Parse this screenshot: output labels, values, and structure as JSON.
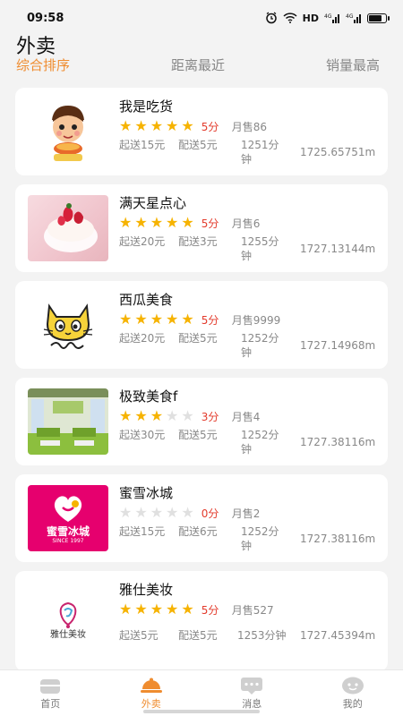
{
  "status_bar": {
    "time": "09:58",
    "network": "HD",
    "signal1": "4G",
    "signal2": "4G"
  },
  "page_title": "外卖",
  "sort_tabs": [
    {
      "label": "综合排序",
      "active": true
    },
    {
      "label": "距离最近",
      "active": false
    },
    {
      "label": "销量最高",
      "active": false
    }
  ],
  "shops": [
    {
      "name": "我是吃货",
      "stars": 5,
      "score": "5分",
      "monthly": "月售86",
      "min_order": "起送15元",
      "delivery_fee": "配送5元",
      "time": "1251分钟",
      "distance": "1725.65751m",
      "thumb": "cartoon-boy-logo"
    },
    {
      "name": "满天星点心",
      "stars": 5,
      "score": "5分",
      "monthly": "月售6",
      "min_order": "起送20元",
      "delivery_fee": "配送3元",
      "time": "1255分钟",
      "distance": "1727.13144m",
      "thumb": "cake-photo"
    },
    {
      "name": "西瓜美食",
      "stars": 5,
      "score": "5分",
      "monthly": "月售9999",
      "min_order": "起送20元",
      "delivery_fee": "配送5元",
      "time": "1252分钟",
      "distance": "1727.14968m",
      "thumb": "cat-logo"
    },
    {
      "name": "极致美食f",
      "stars": 3,
      "score": "3分",
      "monthly": "月售4",
      "min_order": "起送30元",
      "delivery_fee": "配送5元",
      "time": "1252分钟",
      "distance": "1727.38116m",
      "thumb": "restaurant-interior-photo"
    },
    {
      "name": "蜜雪冰城",
      "stars": 0,
      "score": "0分",
      "monthly": "月售2",
      "min_order": "起送15元",
      "delivery_fee": "配送6元",
      "time": "1252分钟",
      "distance": "1727.38116m",
      "thumb": "mixue-logo",
      "logo_text": "蜜雪冰城",
      "logo_sub": "SINCE 1997"
    },
    {
      "name": "雅仕美妆",
      "stars": 5,
      "score": "5分",
      "monthly": "月售527",
      "min_order": "起送5元",
      "delivery_fee": "配送5元",
      "time": "1253分钟",
      "distance": "1727.45394m",
      "thumb": "beauty-logo",
      "logo_text": "雅仕美妆"
    }
  ],
  "tabbar": [
    {
      "label": "首页",
      "icon": "home-icon",
      "active": false
    },
    {
      "label": "外卖",
      "icon": "takeout-icon",
      "active": true
    },
    {
      "label": "消息",
      "icon": "message-icon",
      "active": false
    },
    {
      "label": "我的",
      "icon": "profile-icon",
      "active": false
    }
  ],
  "colors": {
    "accent": "#ef8c2f",
    "star": "#f6b300",
    "score": "#e33b2c",
    "muted": "#888888"
  }
}
